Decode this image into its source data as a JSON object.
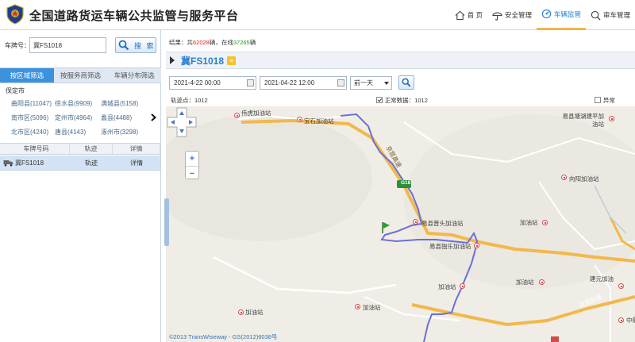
{
  "header": {
    "title": "全国道路货运车辆公共监管与服务平台",
    "nav": [
      {
        "label": "首 页",
        "icon": "home-icon"
      },
      {
        "label": "安全管理",
        "icon": "umbrella-icon"
      },
      {
        "label": "车辆监管",
        "icon": "dashboard-icon",
        "active": true
      },
      {
        "label": "审车管理",
        "icon": "search-icon"
      }
    ]
  },
  "search": {
    "label": "车牌号：",
    "value": "冀FS1018",
    "button": "搜 索"
  },
  "tabs": [
    "按区域筛选",
    "按服务商筛选",
    "车辆分布筛选"
  ],
  "region": {
    "city": "保定市",
    "counties": [
      "曲阳县(11047)",
      "徐水县(9909)",
      "满城县(5158)",
      "南市区(5096)",
      "定州市(4964)",
      "蠡县(4488)",
      "北市区(4240)",
      "唐县(4143)",
      "涿州市(3298)"
    ],
    "more_arrow": "›"
  },
  "grid": {
    "headers": [
      "车牌号码",
      "轨迹",
      "详情"
    ],
    "rows": [
      {
        "plate": "冀FS1018",
        "track": "轨迹",
        "detail": "详情"
      }
    ]
  },
  "result": {
    "prefix": "结果：共",
    "total": "62028",
    "mid": "辆，在线",
    "online": "37265",
    "suffix": "辆"
  },
  "vehicle": {
    "plate": "冀FS1018",
    "badge": "≡"
  },
  "filter": {
    "start": "2021-4-22 00:00",
    "end": "2021-04-22 12:00",
    "period": "前一天"
  },
  "track": {
    "points_label": "轨迹点：1012",
    "normal_label": "正常数据：1012",
    "abnormal_label": "异常"
  },
  "map": {
    "copyright": "©2013 TransWiseway - GS(2012)6038号",
    "road_label": "京昆高速",
    "road_label_2": "京昆高速",
    "shield": "G18",
    "pois": [
      {
        "name": "伟虎加油站"
      },
      {
        "name": "宝石加油站"
      },
      {
        "name": "易县塘湖建平加油站"
      },
      {
        "name": "向阳加油站"
      },
      {
        "name": "加油站"
      },
      {
        "name": "易县普头加油站"
      },
      {
        "name": "易县独乐加油站"
      },
      {
        "name": "加油站"
      },
      {
        "name": "加油站"
      },
      {
        "name": "建元加油"
      },
      {
        "name": "加油站"
      },
      {
        "name": "加油站"
      },
      {
        "name": "中鼎"
      }
    ]
  },
  "colors": {
    "accent": "#1f80d6",
    "tab_active": "#3c92dc",
    "route": "#6a6fd8",
    "highway": "#f2b84b"
  }
}
